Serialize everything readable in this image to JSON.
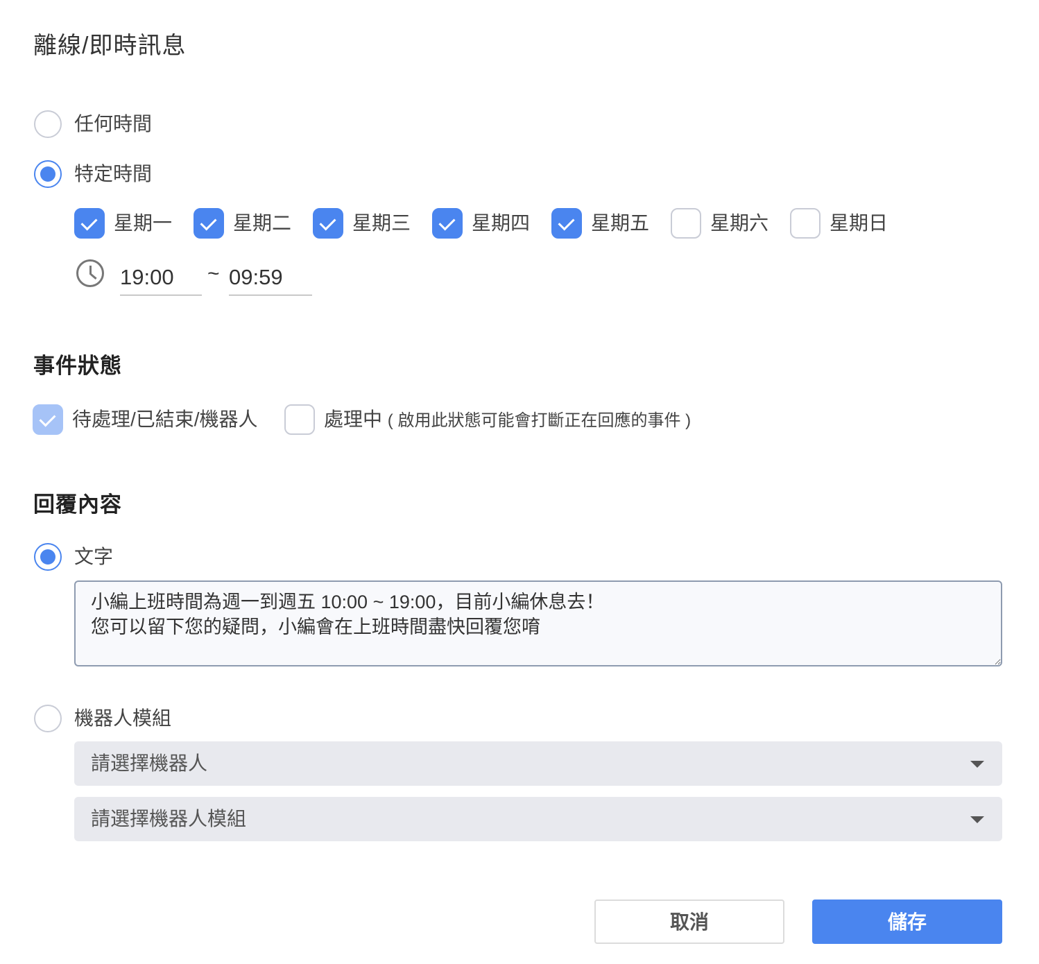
{
  "page_title": "離線/即時訊息",
  "schedule": {
    "options": [
      {
        "label": "任何時間",
        "selected": false
      },
      {
        "label": "特定時間",
        "selected": true
      }
    ],
    "days": [
      {
        "label": "星期一",
        "checked": true
      },
      {
        "label": "星期二",
        "checked": true
      },
      {
        "label": "星期三",
        "checked": true
      },
      {
        "label": "星期四",
        "checked": true
      },
      {
        "label": "星期五",
        "checked": true
      },
      {
        "label": "星期六",
        "checked": false
      },
      {
        "label": "星期日",
        "checked": false
      }
    ],
    "start_time": "19:00",
    "separator": "~",
    "end_time": "09:59"
  },
  "event_status": {
    "title": "事件狀態",
    "options": [
      {
        "label": "待處理/已結束/機器人",
        "checked": true,
        "disabled": true
      },
      {
        "label": "處理中",
        "note": "( 啟用此狀態可能會打斷正在回應的事件 )",
        "checked": false
      }
    ]
  },
  "reply": {
    "title": "回覆內容",
    "text_option": {
      "label": "文字",
      "selected": true
    },
    "text_value": "小編上班時間為週一到週五 10:00 ~ 19:00，目前小編休息去！\n您可以留下您的疑問，小編會在上班時間盡快回覆您唷",
    "bot_option": {
      "label": "機器人模組",
      "selected": false
    },
    "bot_select_placeholder": "請選擇機器人",
    "bot_module_select_placeholder": "請選擇機器人模組"
  },
  "buttons": {
    "cancel": "取消",
    "save": "儲存"
  },
  "colors": {
    "accent": "#4a85ef",
    "accent_disabled": "#a6c3f7",
    "border": "#c9ccd6"
  }
}
